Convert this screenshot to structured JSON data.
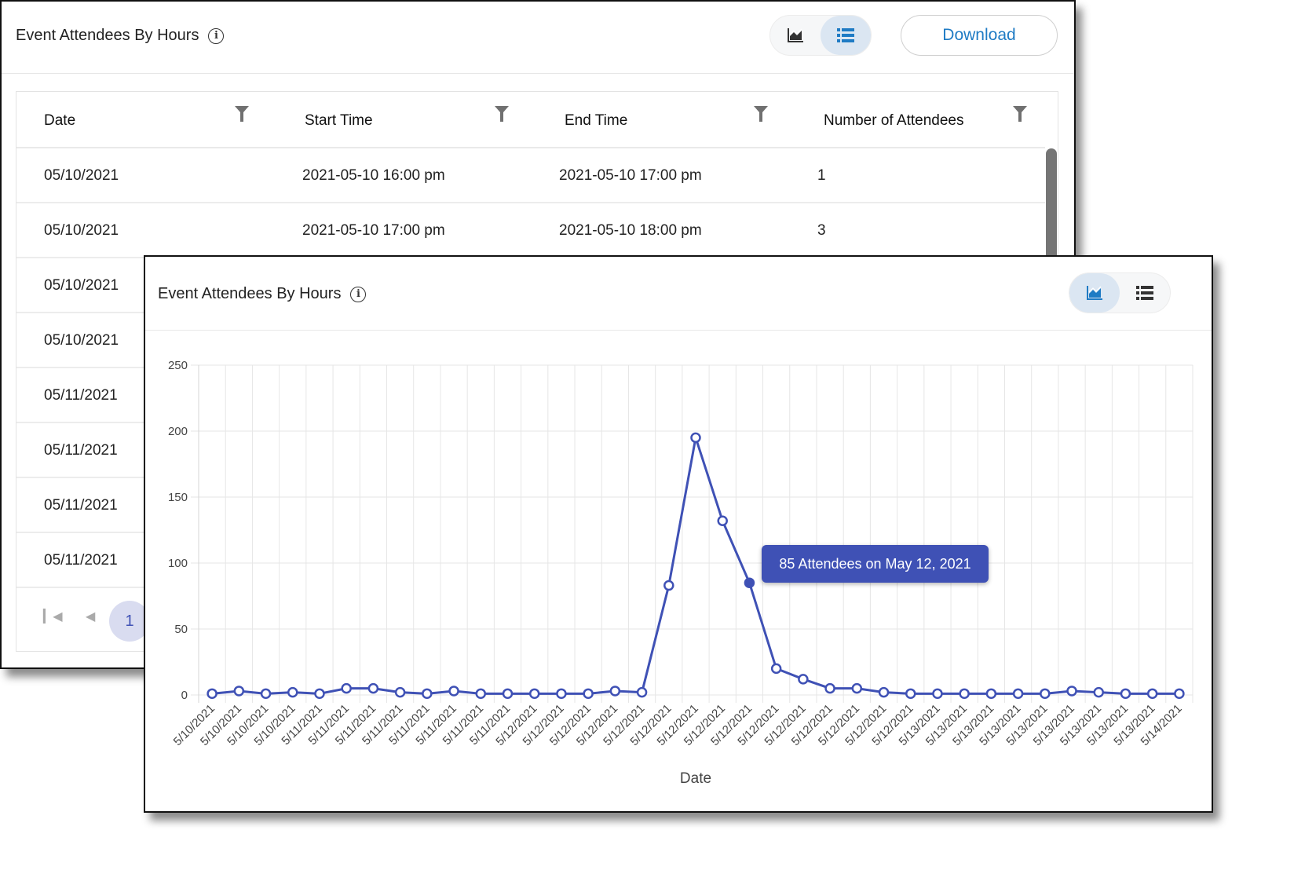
{
  "table_card": {
    "title": "Event Attendees By Hours",
    "view_toggle": {
      "chart_icon": "chart-line-icon",
      "list_icon": "list-icon",
      "active": "list"
    },
    "download_label": "Download",
    "columns": [
      "Date",
      "Start Time",
      "End Time",
      "Number of Attendees"
    ],
    "rows": [
      [
        "05/10/2021",
        "2021-05-10 16:00 pm",
        "2021-05-10 17:00 pm",
        "1"
      ],
      [
        "05/10/2021",
        "2021-05-10 17:00 pm",
        "2021-05-10 18:00 pm",
        "3"
      ],
      [
        "05/10/2021",
        "",
        "",
        ""
      ],
      [
        "05/10/2021",
        "",
        "",
        ""
      ],
      [
        "05/11/2021",
        "",
        "",
        ""
      ],
      [
        "05/11/2021",
        "",
        "",
        ""
      ],
      [
        "05/11/2021",
        "",
        "",
        ""
      ],
      [
        "05/11/2021",
        "",
        "",
        ""
      ]
    ],
    "pager": {
      "first_icon": "first-page-icon",
      "prev_icon": "prev-page-icon",
      "current_page": "1"
    }
  },
  "chart_card": {
    "title": "Event Attendees By Hours",
    "view_toggle": {
      "chart_icon": "chart-line-icon",
      "list_icon": "list-icon",
      "active": "chart"
    },
    "tooltip": "85 Attendees on May 12, 2021",
    "tooltip_index": 20,
    "colors": {
      "line": "#3f51b5",
      "tooltip_bg": "#3f51b5",
      "grid": "#e6e6e6"
    }
  },
  "chart_data": {
    "type": "line",
    "title": "Event Attendees By Hours",
    "xlabel": "Date",
    "ylabel": "",
    "ylim": [
      0,
      250
    ],
    "yticks": [
      0,
      50,
      100,
      150,
      200,
      250
    ],
    "grid": true,
    "legend": "none",
    "categories": [
      "5/10/2021",
      "5/10/2021",
      "5/10/2021",
      "5/10/2021",
      "5/11/2021",
      "5/11/2021",
      "5/11/2021",
      "5/11/2021",
      "5/11/2021",
      "5/11/2021",
      "5/11/2021",
      "5/11/2021",
      "5/12/2021",
      "5/12/2021",
      "5/12/2021",
      "5/12/2021",
      "5/12/2021",
      "5/12/2021",
      "5/12/2021",
      "5/12/2021",
      "5/12/2021",
      "5/12/2021",
      "5/12/2021",
      "5/12/2021",
      "5/12/2021",
      "5/12/2021",
      "5/12/2021",
      "5/13/2021",
      "5/13/2021",
      "5/13/2021",
      "5/13/2021",
      "5/13/2021",
      "5/13/2021",
      "5/13/2021",
      "5/13/2021",
      "5/13/2021",
      "5/14/2021"
    ],
    "series": [
      {
        "name": "Attendees",
        "values": [
          1,
          3,
          1,
          2,
          1,
          5,
          5,
          2,
          1,
          3,
          1,
          1,
          1,
          1,
          1,
          3,
          2,
          83,
          195,
          132,
          85,
          20,
          12,
          5,
          5,
          2,
          1,
          1,
          1,
          1,
          1,
          1,
          3,
          2,
          1,
          1,
          1
        ]
      }
    ]
  }
}
